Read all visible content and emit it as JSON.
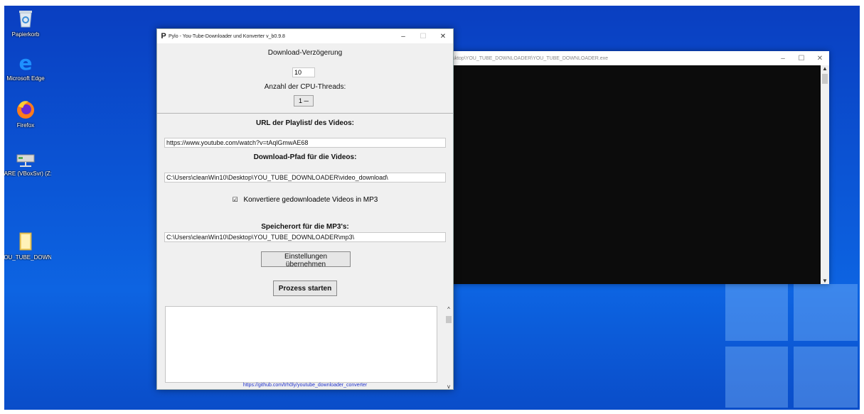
{
  "desktop": {
    "icons": [
      {
        "name": "recycle-bin",
        "label": "Papierkorb"
      },
      {
        "name": "edge",
        "label": "Microsoft Edge"
      },
      {
        "name": "firefox",
        "label": "Firefox"
      },
      {
        "name": "network-drive",
        "label": "HARE (VBoxSvr) (Z:)"
      },
      {
        "name": "folder",
        "label": "YOU_TUBE_DOWN..."
      }
    ]
  },
  "console": {
    "title": "sktop\\YOU_TUBE_DOWNLOADER\\YOU_TUBE_DOWNLOADER.exe",
    "min": "–",
    "max": "☐",
    "close": "✕",
    "up": "▲",
    "down": "▼"
  },
  "app": {
    "title": "Pylo - You-Tube-Downloader und Konverter v_b0.9.8",
    "icon_glyph": "P",
    "min": "–",
    "max": "☐",
    "close": "✕",
    "delay_label": "Download-Verzögerung",
    "delay_value": "10",
    "threads_label": "Anzahl der CPU-Threads:",
    "threads_value": "1 ─",
    "url_label": "URL der Playlist/ des Videos:",
    "url_value": "https://www.youtube.com/watch?v=tAqlGmwAE68",
    "path_label": "Download-Pfad für die Videos:",
    "path_value": "C:\\Users\\cleanWin10\\Desktop\\YOU_TUBE_DOWNLOADER\\video_download\\",
    "convert_check": "☑",
    "convert_label": "Konvertiere gedownloadete Videos in MP3",
    "mp3_label": "Speicherort für die MP3's:",
    "mp3_value": "C:\\Users\\cleanWin10\\Desktop\\YOU_TUBE_DOWNLOADER\\mp3\\",
    "apply_button": "Einstellungen übernehmen",
    "start_button": "Prozess starten",
    "scroll_up": "^",
    "scroll_down": "v",
    "footer_link": "https://github.com/trh0ly/youtube_downloader_converter"
  }
}
